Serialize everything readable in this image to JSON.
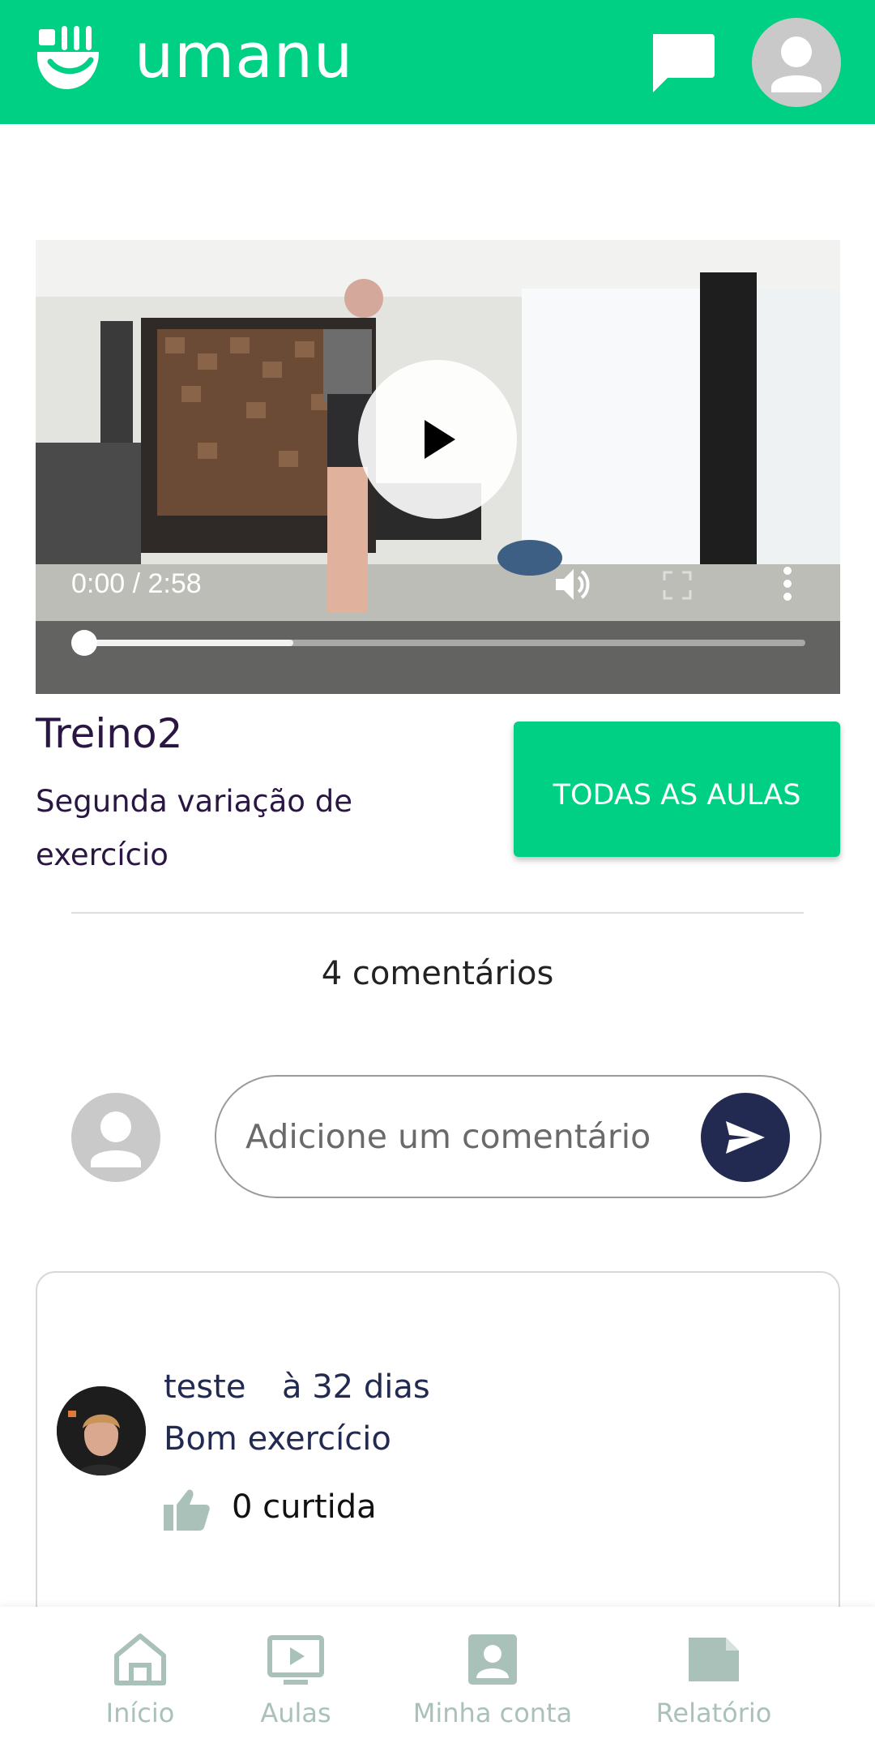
{
  "header": {
    "brand": "umanu",
    "logo_icon": "umanu-logo-icon",
    "chat_icon": "chat-icon",
    "avatar_icon": "user-avatar-icon",
    "color": "#00d084"
  },
  "video": {
    "time": "0:00 / 2:58",
    "progress": 0,
    "buffered": 0.29,
    "play_icon": "play-icon",
    "volume_icon": "volume-icon",
    "fullscreen_icon": "fullscreen-icon",
    "more_icon": "more-vertical-icon"
  },
  "lesson": {
    "title": "Treino2",
    "subtitle": "Segunda variação de exercício",
    "all_button": "TODAS AS AULAS"
  },
  "comments": {
    "count_label": "4 comentários",
    "input_placeholder": "Adicione um comentário",
    "send_icon": "send-icon",
    "items": [
      {
        "author": "teste",
        "time": "à 32 dias",
        "text": "Bom exercício",
        "likes_label": "0 curtida"
      }
    ]
  },
  "bottom_nav": {
    "items": [
      {
        "label": "Início",
        "icon": "home-icon"
      },
      {
        "label": "Aulas",
        "icon": "video-lessons-icon"
      },
      {
        "label": "Minha conta",
        "icon": "account-icon"
      },
      {
        "label": "Relatório",
        "icon": "report-icon"
      }
    ],
    "inactive_color": "#a9c1b8"
  }
}
